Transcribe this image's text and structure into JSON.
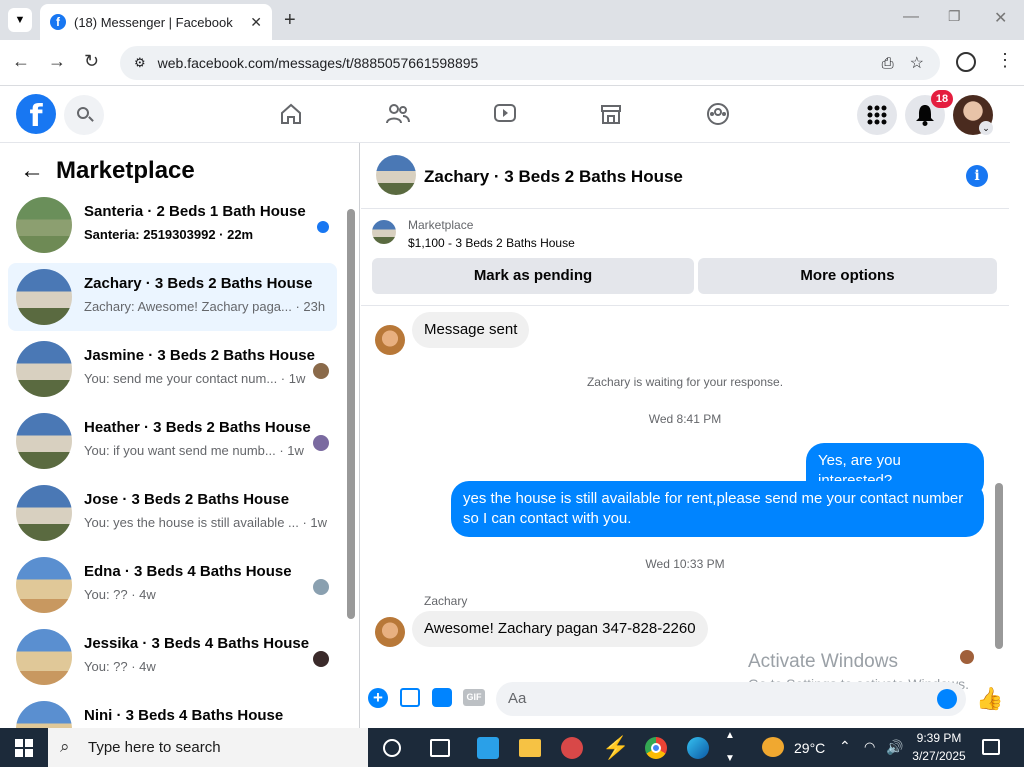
{
  "browser": {
    "tab_title": "(18) Messenger | Facebook",
    "url": "web.facebook.com/messages/t/8885057661598895"
  },
  "fbnav": {
    "notification_count": "18"
  },
  "sidebar": {
    "title": "Marketplace",
    "conversations": [
      {
        "name": "Santeria · 2 Beds 1 Bath House",
        "snippet": "Santeria: 2519303992 · 22m",
        "unread": true
      },
      {
        "name": "Zachary · 3 Beds 2 Baths House",
        "snippet": "Zachary: Awesome! Zachary paga... · 23h",
        "active": true
      },
      {
        "name": "Jasmine · 3 Beds 2 Baths House",
        "snippet": "You: send me your contact num... · 1w"
      },
      {
        "name": "Heather · 3 Beds 2 Baths House",
        "snippet": "You: if you want send me numb... · 1w"
      },
      {
        "name": "Jose · 3 Beds 2 Baths House",
        "snippet": "You: yes the house is still available ... · 1w"
      },
      {
        "name": "Edna · 3 Beds 4 Baths House",
        "snippet": "You: ?? · 4w"
      },
      {
        "name": "Jessika · 3 Beds 4 Baths House",
        "snippet": "You: ?? · 4w"
      },
      {
        "name": "Nini · 3 Beds 4 Baths House",
        "snippet": ""
      }
    ]
  },
  "chat": {
    "title": "Zachary · 3 Beds 2 Baths House",
    "listing_label": "Marketplace",
    "listing_price": "$1,100 - 3 Beds 2 Baths House",
    "mark_pending": "Mark as pending",
    "more_options": "More options",
    "msg1": "Message sent",
    "waiting": "Zachary is waiting for your response.",
    "time1": "Wed 8:41 PM",
    "out1": "Yes, are you interested?",
    "out2": "yes the house is still available for rent,please send me your contact number so I can contact with you.",
    "time2": "Wed 10:33 PM",
    "sender": "Zachary",
    "in2": "Awesome! Zachary pagan 347-828-2260",
    "composer_placeholder": "Aa",
    "watermark_title": "Activate Windows",
    "watermark_sub": "Go to Settings to activate Windows."
  },
  "taskbar": {
    "search_placeholder": "Type here to search",
    "temperature": "29°C",
    "time": "9:39 PM",
    "date": "3/27/2025"
  },
  "colors": {
    "brand": "#1877f2",
    "outgoing": "#0084ff",
    "badge": "#e41e3f"
  }
}
